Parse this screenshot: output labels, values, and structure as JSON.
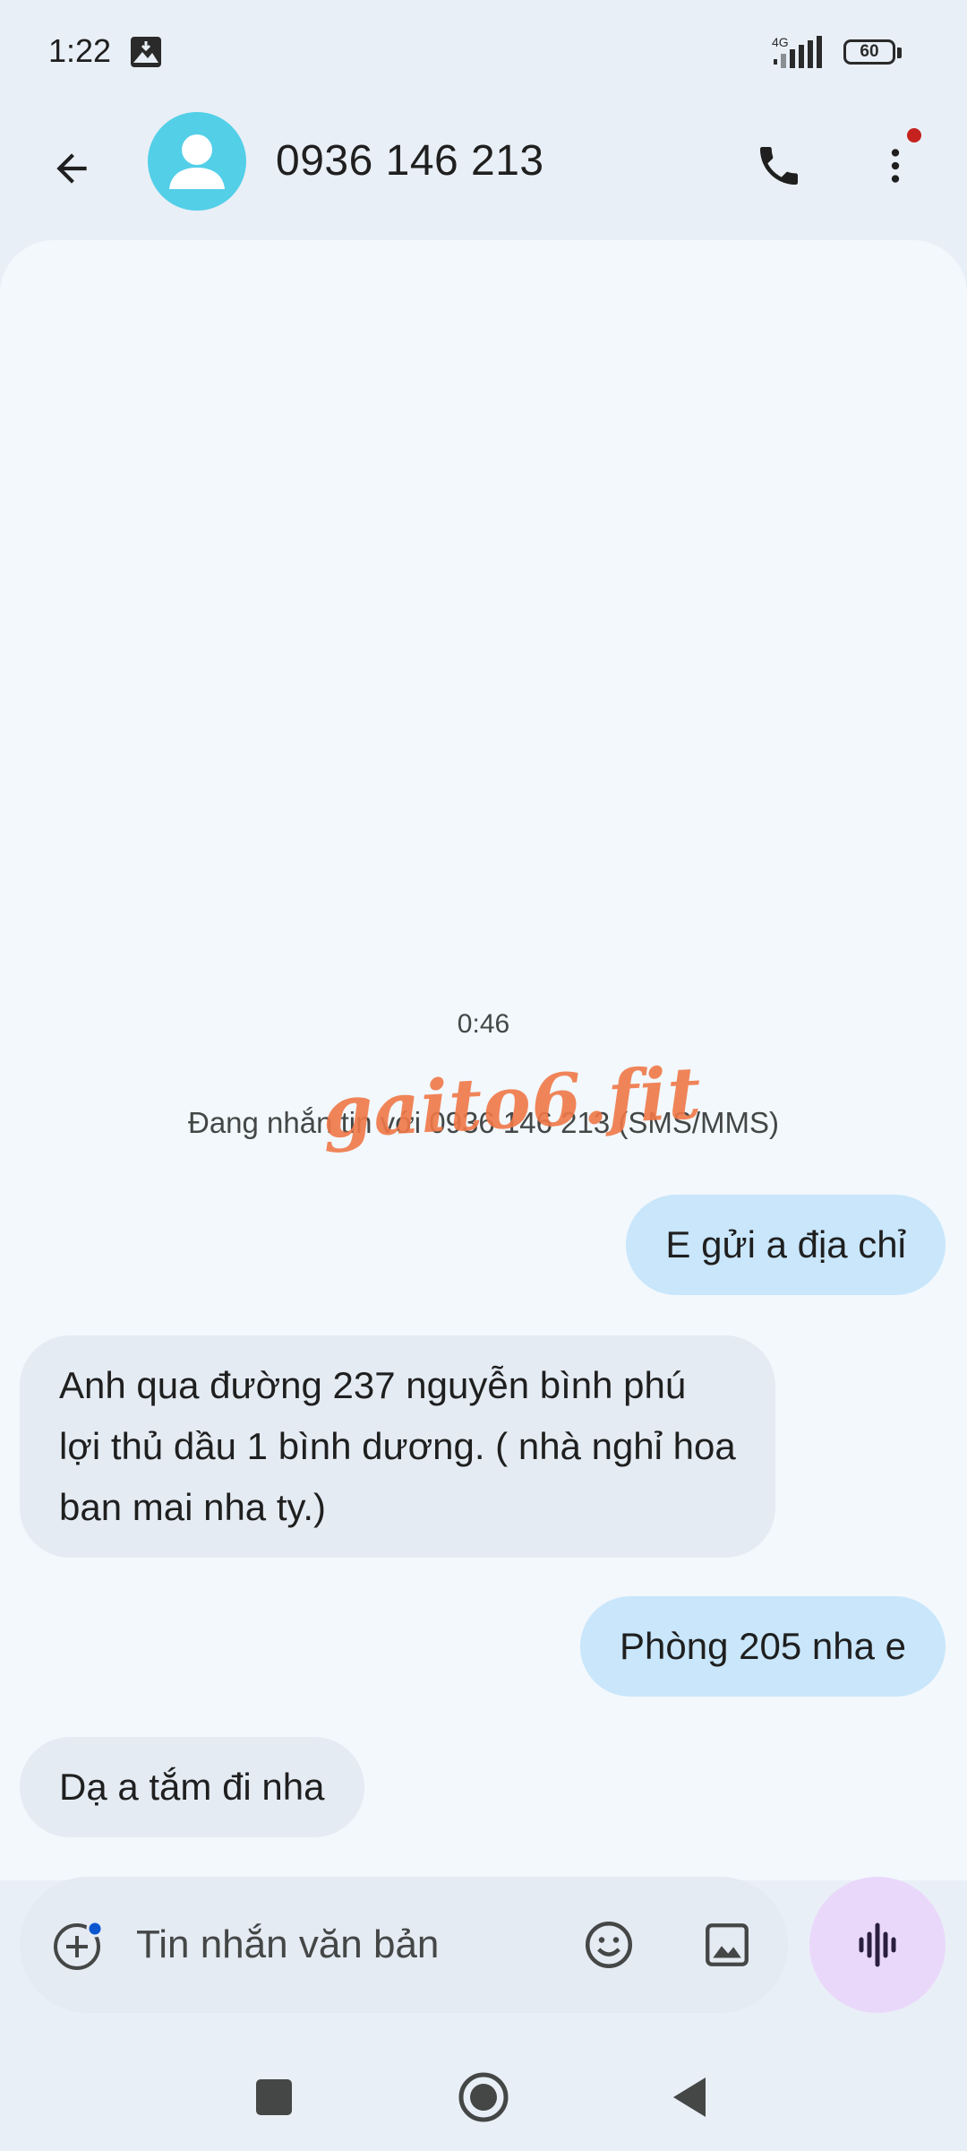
{
  "status_bar": {
    "time": "1:22",
    "network": "4G",
    "battery": "60"
  },
  "header": {
    "contact": "0936 146 213",
    "icons": [
      "back-arrow-icon",
      "avatar-person-icon",
      "phone-icon",
      "more-vert-icon"
    ],
    "notification_dot_color": "#c5221f"
  },
  "conversation": {
    "timestamp": "0:46",
    "info": "Đang nhắn tin với 0936 146 213 (SMS/MMS)",
    "watermark": "gaito6.fit",
    "messages": [
      {
        "direction": "outgoing",
        "text": "E gửi a địa chỉ"
      },
      {
        "direction": "incoming",
        "text": "Anh qua đường 237 nguyễn bình phú lợi thủ dầu 1 bình dương. ( nhà nghỉ hoa ban mai nha ty.)"
      },
      {
        "direction": "outgoing",
        "text": "Phòng 205 nha e"
      },
      {
        "direction": "incoming",
        "text": "Dạ a tắm đi nha"
      }
    ]
  },
  "compose": {
    "placeholder": "Tin nhắn văn bản",
    "value": "",
    "icons": [
      "attach-add-icon",
      "emoji-icon",
      "gallery-icon",
      "voice-waveform-icon"
    ]
  },
  "nav": {
    "icons": [
      "recents-square-icon",
      "home-circle-icon",
      "back-triangle-icon"
    ]
  },
  "colors": {
    "outgoing_bubble": "#c9e6fb",
    "incoming_bubble": "#e4ebf3",
    "avatar": "#53cfe8",
    "voice_button": "#ead8fb",
    "watermark": "#f07848"
  }
}
